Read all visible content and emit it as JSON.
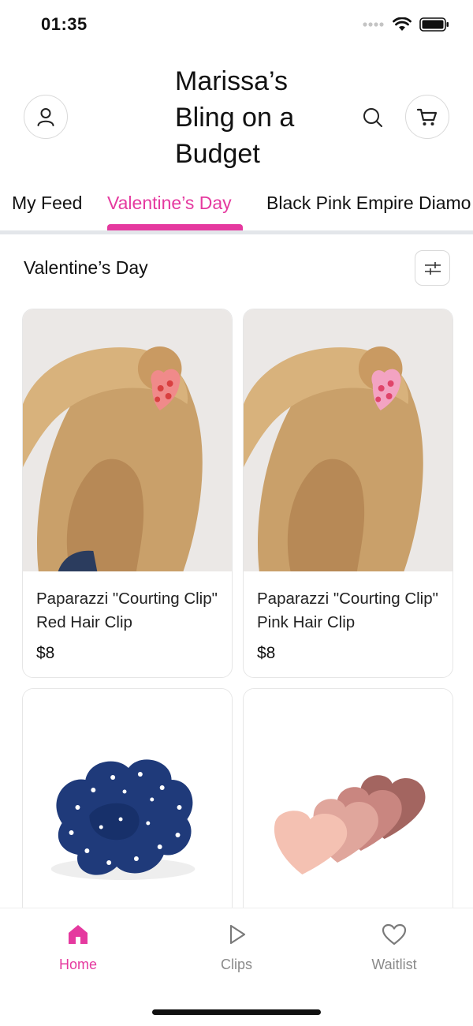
{
  "status_bar": {
    "time": "01:35"
  },
  "header": {
    "shop_name": "Marissa’s Bling on a Budget"
  },
  "tabs": [
    {
      "label": "My Feed",
      "active": false
    },
    {
      "label": "Valentine’s Day",
      "active": true
    },
    {
      "label": "Black Pink Empire Diamo",
      "active": false
    }
  ],
  "section": {
    "title": "Valentine’s Day"
  },
  "products": [
    {
      "name": "Paparazzi \"Courting Clip\" Red Hair Clip",
      "price": "$8"
    },
    {
      "name": "Paparazzi \"Courting Clip\" Pink Hair Clip",
      "price": "$8"
    }
  ],
  "bottom_nav": {
    "items": [
      {
        "label": "Home",
        "icon": "home-icon",
        "active": true
      },
      {
        "label": "Clips",
        "icon": "play-icon",
        "active": false
      },
      {
        "label": "Waitlist",
        "icon": "heart-icon",
        "active": false
      }
    ]
  },
  "colors": {
    "accent": "#e5399f",
    "divider": "#e3e6ea",
    "inactive": "#8a8a8a"
  }
}
